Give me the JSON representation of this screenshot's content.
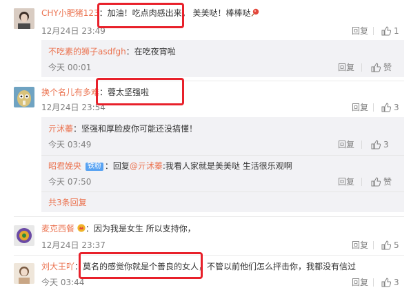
{
  "comments": [
    {
      "username": "CHY小肥猪123",
      "text_a": "：加油！吃点肉感出来。",
      "text_b": "美美哒！棒棒哒",
      "time": "12月24日 23:49",
      "reply": "回复",
      "likes": "1",
      "replies": [
        {
          "username": "不吃素的狮子asdfgh",
          "text": "：在吃夜宵啦",
          "time": "今天 00:01",
          "reply": "回复",
          "likes": "赞"
        }
      ]
    },
    {
      "username": "换个名儿有多难",
      "text": "：蓉太坚强啦",
      "time": "12月24日 23:54",
      "reply": "回复",
      "likes": "3",
      "replies": [
        {
          "username": "亓沭蓁",
          "text": "：坚强和厚脸皮你可能还没搞懂！",
          "time": "今天 03:49",
          "reply": "回复",
          "likes": "3"
        },
        {
          "username": "昭君娩央",
          "badge": "铁粉",
          "text_a": "：回复",
          "mention": "@亓沭蓁",
          "text_b": ":我看人家就是美美哒 生活很乐观啊",
          "time": "今天 07:50",
          "reply": "回复",
          "likes": "赞"
        }
      ],
      "more": "共3条回复"
    },
    {
      "username": "麦克西餐",
      "text": "：因为我是女生 所以支持你，",
      "time": "12月24日 23:37",
      "reply": "回复",
      "likes": "5"
    },
    {
      "username": "刘大王吖",
      "text": "：莫名的感觉你就是个善良的女人，不管以前他们怎么抨击你，我都没有信过",
      "time": "今天 03:44",
      "reply": "回复",
      "likes": "3"
    }
  ],
  "colors": {
    "username": "#eb7350",
    "highlight_box": "#e8202a",
    "badge": "#58a2f2"
  }
}
